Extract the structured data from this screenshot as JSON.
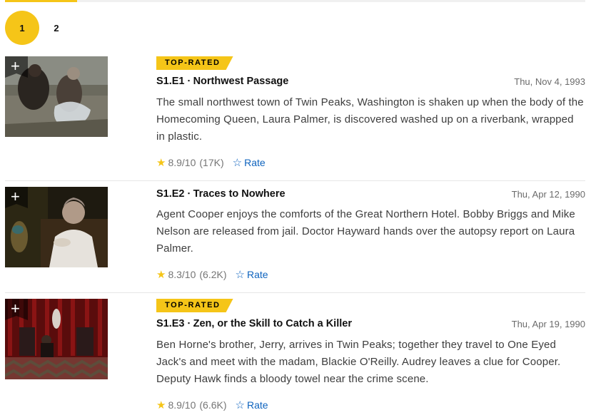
{
  "pagination": {
    "pages": [
      "1",
      "2"
    ],
    "active": "1"
  },
  "colors": {
    "accent": "#f5c518",
    "link": "#0e63be"
  },
  "episodes": [
    {
      "badge": "TOP-RATED",
      "title": "S1.E1 ∙ Northwest Passage",
      "date": "Thu, Nov 4, 1993",
      "description": "The small northwest town of Twin Peaks, Washington is shaken up when the body of the Homecoming Queen, Laura Palmer, is discovered washed up on a riverbank, wrapped in plastic.",
      "rating": "8.9",
      "rating_max": "/10",
      "votes": "(17K)",
      "rate_label": "Rate"
    },
    {
      "badge": "",
      "title": "S1.E2 ∙ Traces to Nowhere",
      "date": "Thu, Apr 12, 1990",
      "description": "Agent Cooper enjoys the comforts of the Great Northern Hotel. Bobby Briggs and Mike Nelson are released from jail. Doctor Hayward hands over the autopsy report on Laura Palmer.",
      "rating": "8.3",
      "rating_max": "/10",
      "votes": "(6.2K)",
      "rate_label": "Rate"
    },
    {
      "badge": "TOP-RATED",
      "title": "S1.E3 ∙ Zen, or the Skill to Catch a Killer",
      "date": "Thu, Apr 19, 1990",
      "description": "Ben Horne's brother, Jerry, arrives in Twin Peaks; together they travel to One Eyed Jack's and meet with the madam, Blackie O'Reilly. Audrey leaves a clue for Cooper. Deputy Hawk finds a bloody towel near the crime scene.",
      "rating": "8.9",
      "rating_max": "/10",
      "votes": "(6.6K)",
      "rate_label": "Rate"
    }
  ],
  "icons": {
    "add": "plus-icon",
    "star": "star-filled-icon",
    "rate": "star-outline-icon"
  }
}
